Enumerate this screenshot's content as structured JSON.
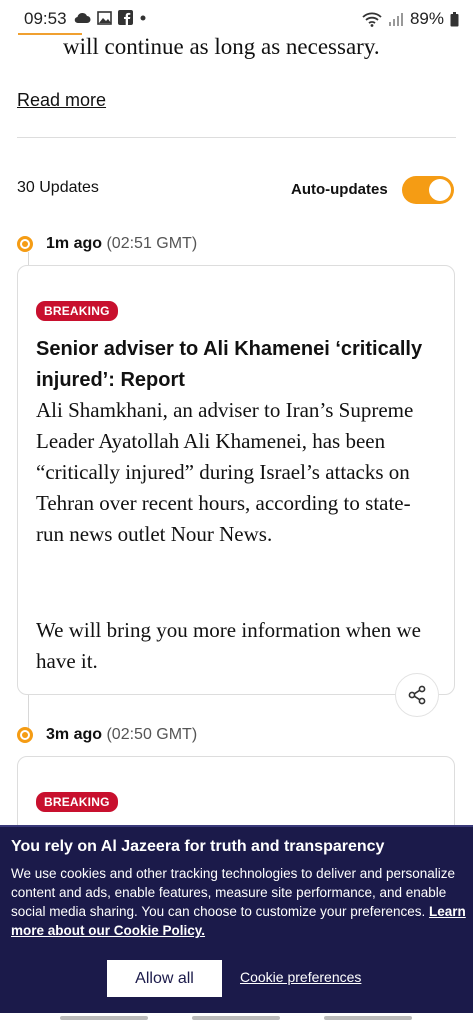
{
  "status_bar": {
    "time": "09:53",
    "battery": "89%"
  },
  "article": {
    "top_text": "will continue as long as necessary.",
    "read_more": "Read more"
  },
  "live": {
    "updates_count": "30 Updates",
    "auto_updates_label": "Auto-updates",
    "auto_updates_on": true
  },
  "posts": [
    {
      "ago": "1m ago",
      "time": "(02:51 GMT)",
      "badge": "BREAKING",
      "title": "Senior adviser to Ali Khamenei ‘critically injured’: Report",
      "body1": "Ali Shamkhani, an adviser to Iran’s Supreme Leader Ayatollah Ali Khamenei, has been “critically injured” during Israel’s attacks on Tehran over recent hours, according to state-run news outlet Nour News.",
      "body2": "We will bring you more information when we have it."
    },
    {
      "ago": "3m ago",
      "time": "(02:50 GMT)",
      "badge": "BREAKING"
    }
  ],
  "cookie": {
    "title": "You rely on Al Jazeera for truth and transparency",
    "text": "We use cookies and other tracking technologies to deliver and personalize content and ads, enable features, measure site performance, and enable social media sharing. You can choose to customize your preferences.",
    "policy_link": "Learn more about our Cookie Policy.",
    "allow_all": "Allow all",
    "preferences": "Cookie preferences"
  },
  "colors": {
    "accent": "#f59c14",
    "breaking": "#c8102e",
    "banner": "#1b1a4a"
  }
}
